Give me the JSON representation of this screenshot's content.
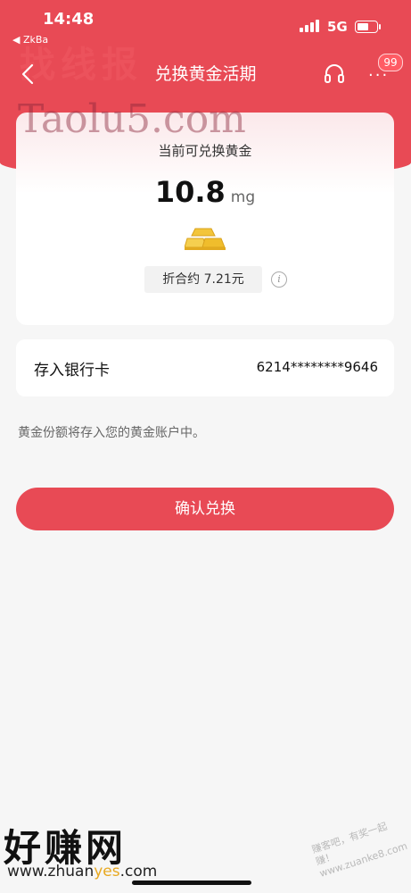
{
  "status_bar": {
    "time": "14:48",
    "back_app": "◀ ZkBa",
    "network": "5G",
    "icons": [
      "signal-icon",
      "battery-icon"
    ]
  },
  "header": {
    "title": "兑换黄金活期",
    "back_icon": "chevron-left-icon",
    "service_icon": "headset-icon",
    "more_icon": "more-icon",
    "badge_count": "99"
  },
  "watermarks": {
    "top": "找线报",
    "middle": "Taolu5.com"
  },
  "gold_card": {
    "title": "当前可兑换黄金",
    "amount": "10.8",
    "unit": "mg",
    "icon": "gold-bar-icon",
    "equivalent": "折合约 7.21元",
    "info_icon": "info-icon"
  },
  "bank_card": {
    "label": "存入银行卡",
    "number": "6214********9646"
  },
  "notice": "黄金份额将存入您的黄金账户中。",
  "confirm_button": "确认兑换",
  "footer": {
    "logo": "好赚网",
    "url_prefix": "www.zhuan",
    "url_highlight": "yes",
    "url_suffix": ".com",
    "stamp_line1": "赚客吧，有奖一起赚！",
    "stamp_line2": "www.zuanke8.com"
  },
  "colors": {
    "brand_red": "#e84a55",
    "background": "#f6f6f6",
    "card": "#ffffff"
  }
}
